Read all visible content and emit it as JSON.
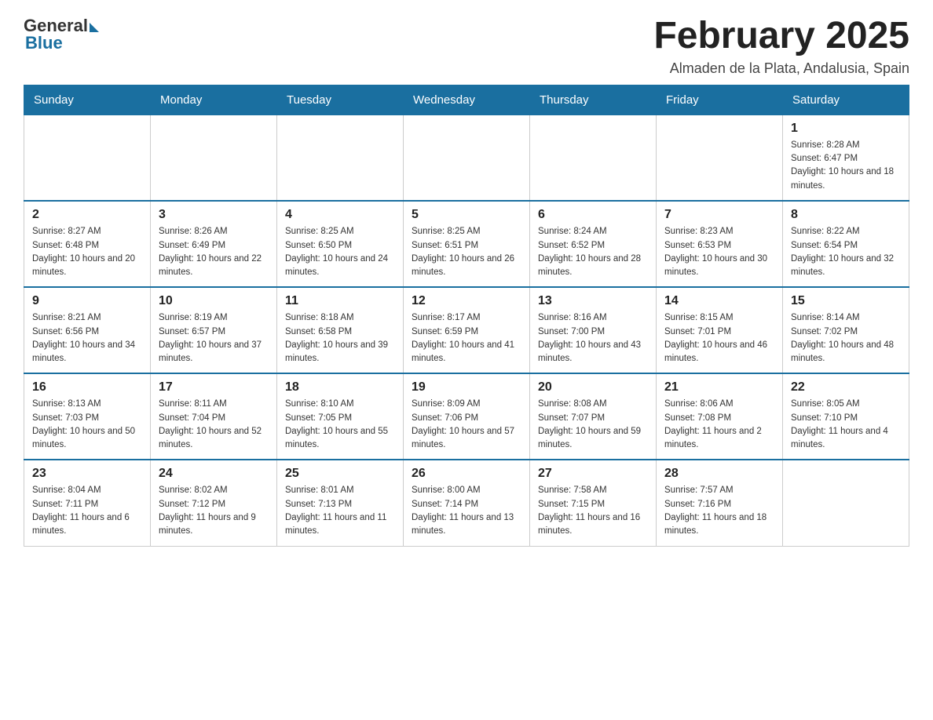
{
  "logo": {
    "general": "General",
    "blue": "Blue"
  },
  "title": "February 2025",
  "location": "Almaden de la Plata, Andalusia, Spain",
  "days_of_week": [
    "Sunday",
    "Monday",
    "Tuesday",
    "Wednesday",
    "Thursday",
    "Friday",
    "Saturday"
  ],
  "weeks": [
    [
      {
        "day": "",
        "info": ""
      },
      {
        "day": "",
        "info": ""
      },
      {
        "day": "",
        "info": ""
      },
      {
        "day": "",
        "info": ""
      },
      {
        "day": "",
        "info": ""
      },
      {
        "day": "",
        "info": ""
      },
      {
        "day": "1",
        "info": "Sunrise: 8:28 AM\nSunset: 6:47 PM\nDaylight: 10 hours and 18 minutes."
      }
    ],
    [
      {
        "day": "2",
        "info": "Sunrise: 8:27 AM\nSunset: 6:48 PM\nDaylight: 10 hours and 20 minutes."
      },
      {
        "day": "3",
        "info": "Sunrise: 8:26 AM\nSunset: 6:49 PM\nDaylight: 10 hours and 22 minutes."
      },
      {
        "day": "4",
        "info": "Sunrise: 8:25 AM\nSunset: 6:50 PM\nDaylight: 10 hours and 24 minutes."
      },
      {
        "day": "5",
        "info": "Sunrise: 8:25 AM\nSunset: 6:51 PM\nDaylight: 10 hours and 26 minutes."
      },
      {
        "day": "6",
        "info": "Sunrise: 8:24 AM\nSunset: 6:52 PM\nDaylight: 10 hours and 28 minutes."
      },
      {
        "day": "7",
        "info": "Sunrise: 8:23 AM\nSunset: 6:53 PM\nDaylight: 10 hours and 30 minutes."
      },
      {
        "day": "8",
        "info": "Sunrise: 8:22 AM\nSunset: 6:54 PM\nDaylight: 10 hours and 32 minutes."
      }
    ],
    [
      {
        "day": "9",
        "info": "Sunrise: 8:21 AM\nSunset: 6:56 PM\nDaylight: 10 hours and 34 minutes."
      },
      {
        "day": "10",
        "info": "Sunrise: 8:19 AM\nSunset: 6:57 PM\nDaylight: 10 hours and 37 minutes."
      },
      {
        "day": "11",
        "info": "Sunrise: 8:18 AM\nSunset: 6:58 PM\nDaylight: 10 hours and 39 minutes."
      },
      {
        "day": "12",
        "info": "Sunrise: 8:17 AM\nSunset: 6:59 PM\nDaylight: 10 hours and 41 minutes."
      },
      {
        "day": "13",
        "info": "Sunrise: 8:16 AM\nSunset: 7:00 PM\nDaylight: 10 hours and 43 minutes."
      },
      {
        "day": "14",
        "info": "Sunrise: 8:15 AM\nSunset: 7:01 PM\nDaylight: 10 hours and 46 minutes."
      },
      {
        "day": "15",
        "info": "Sunrise: 8:14 AM\nSunset: 7:02 PM\nDaylight: 10 hours and 48 minutes."
      }
    ],
    [
      {
        "day": "16",
        "info": "Sunrise: 8:13 AM\nSunset: 7:03 PM\nDaylight: 10 hours and 50 minutes."
      },
      {
        "day": "17",
        "info": "Sunrise: 8:11 AM\nSunset: 7:04 PM\nDaylight: 10 hours and 52 minutes."
      },
      {
        "day": "18",
        "info": "Sunrise: 8:10 AM\nSunset: 7:05 PM\nDaylight: 10 hours and 55 minutes."
      },
      {
        "day": "19",
        "info": "Sunrise: 8:09 AM\nSunset: 7:06 PM\nDaylight: 10 hours and 57 minutes."
      },
      {
        "day": "20",
        "info": "Sunrise: 8:08 AM\nSunset: 7:07 PM\nDaylight: 10 hours and 59 minutes."
      },
      {
        "day": "21",
        "info": "Sunrise: 8:06 AM\nSunset: 7:08 PM\nDaylight: 11 hours and 2 minutes."
      },
      {
        "day": "22",
        "info": "Sunrise: 8:05 AM\nSunset: 7:10 PM\nDaylight: 11 hours and 4 minutes."
      }
    ],
    [
      {
        "day": "23",
        "info": "Sunrise: 8:04 AM\nSunset: 7:11 PM\nDaylight: 11 hours and 6 minutes."
      },
      {
        "day": "24",
        "info": "Sunrise: 8:02 AM\nSunset: 7:12 PM\nDaylight: 11 hours and 9 minutes."
      },
      {
        "day": "25",
        "info": "Sunrise: 8:01 AM\nSunset: 7:13 PM\nDaylight: 11 hours and 11 minutes."
      },
      {
        "day": "26",
        "info": "Sunrise: 8:00 AM\nSunset: 7:14 PM\nDaylight: 11 hours and 13 minutes."
      },
      {
        "day": "27",
        "info": "Sunrise: 7:58 AM\nSunset: 7:15 PM\nDaylight: 11 hours and 16 minutes."
      },
      {
        "day": "28",
        "info": "Sunrise: 7:57 AM\nSunset: 7:16 PM\nDaylight: 11 hours and 18 minutes."
      },
      {
        "day": "",
        "info": ""
      }
    ]
  ]
}
